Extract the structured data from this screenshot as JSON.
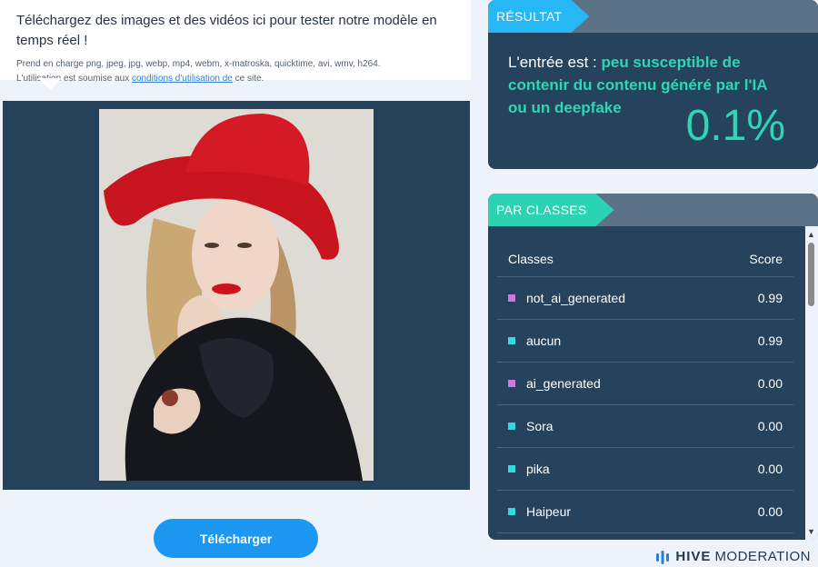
{
  "upload": {
    "title": "Téléchargez des images et des vidéos ici pour tester notre modèle en temps réel !",
    "supports": "Prend en charge png, jpeg, jpg, webp, mp4, webm, x-matroska, quicktime, avi, wmv, h264.",
    "terms_prefix": "L'utilisation est soumise aux ",
    "terms_link": "conditions d'utilisation de",
    "terms_suffix": " ce site.",
    "button_label": "Télécharger"
  },
  "result": {
    "tag": "RÉSULTAT",
    "prefix": "L'entrée est : ",
    "verdict": "peu susceptible de contenir du contenu généré par l'IA ou un deepfake",
    "percent": "0.1%"
  },
  "classes": {
    "tag": "PAR CLASSES",
    "col_class": "Classes",
    "col_score": "Score",
    "rows": [
      {
        "name": "not_ai_generated",
        "score": "0.99",
        "color": "#c77be0"
      },
      {
        "name": "aucun",
        "score": "0.99",
        "color": "#37d8e0"
      },
      {
        "name": "ai_generated",
        "score": "0.00",
        "color": "#c77be0"
      },
      {
        "name": "Sora",
        "score": "0.00",
        "color": "#37d8e0"
      },
      {
        "name": "pika",
        "score": "0.00",
        "color": "#37d8e0"
      },
      {
        "name": "Haipeur",
        "score": "0.00",
        "color": "#37d8e0"
      }
    ]
  },
  "brand": {
    "name_bold": "HIVE",
    "name_light": "MODERATION"
  },
  "colors": {
    "accent_blue": "#28b7f5",
    "accent_teal": "#2cd3b3",
    "panel_bg": "#25435d",
    "button": "#1c98f2"
  }
}
